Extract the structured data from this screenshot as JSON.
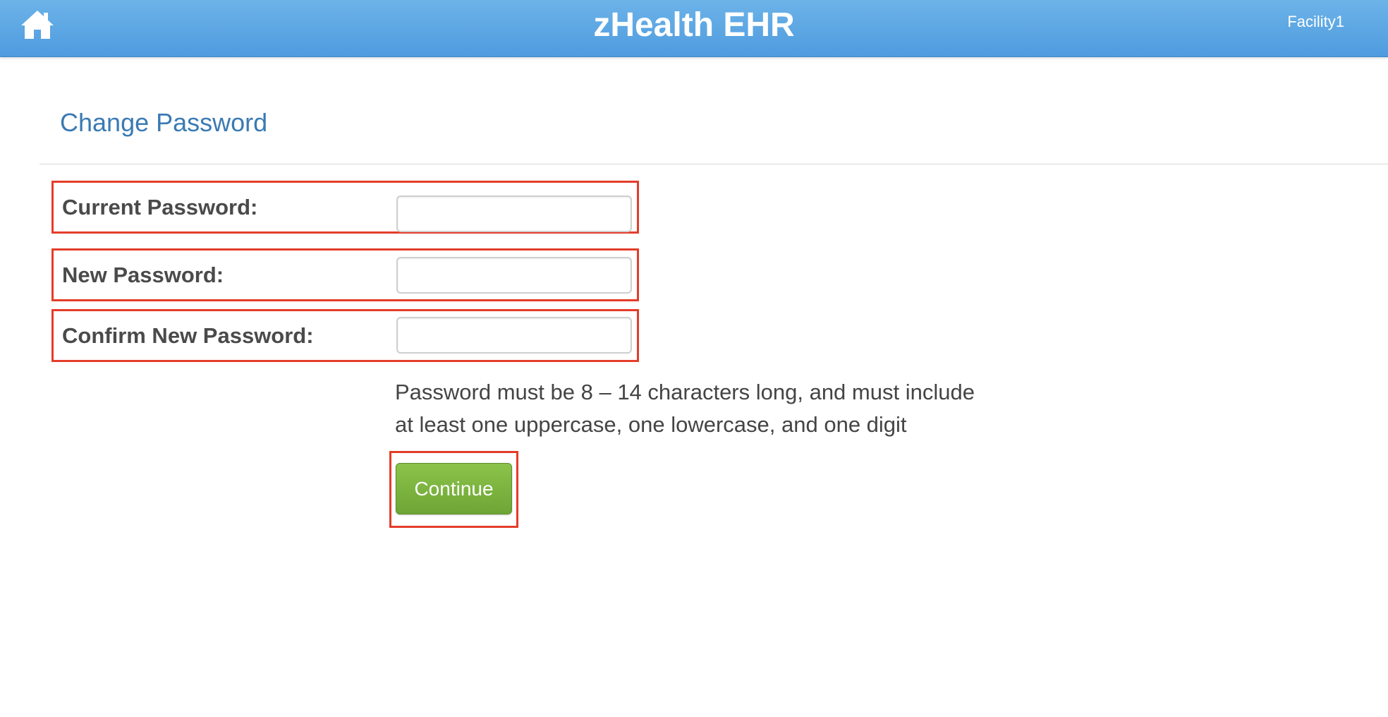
{
  "header": {
    "home_icon": "home-icon",
    "title": "zHealth EHR",
    "facility": "Facility1"
  },
  "page": {
    "title": "Change Password"
  },
  "form": {
    "fields": [
      {
        "label": "Current Password:",
        "value": "",
        "placeholder": ""
      },
      {
        "label": "New Password:",
        "value": "",
        "placeholder": ""
      },
      {
        "label": "Confirm New Password:",
        "value": "",
        "placeholder": ""
      }
    ],
    "hint_lines": [
      "Password must be 8 – 14 characters long, and must include",
      "at least one uppercase, one lowercase, and one digit"
    ],
    "continue_label": "Continue"
  },
  "colors": {
    "header_blue": "#5aa5e3",
    "title_blue": "#3a7ab3",
    "highlight_red": "#e43d2a",
    "button_green": "#7cb342"
  }
}
